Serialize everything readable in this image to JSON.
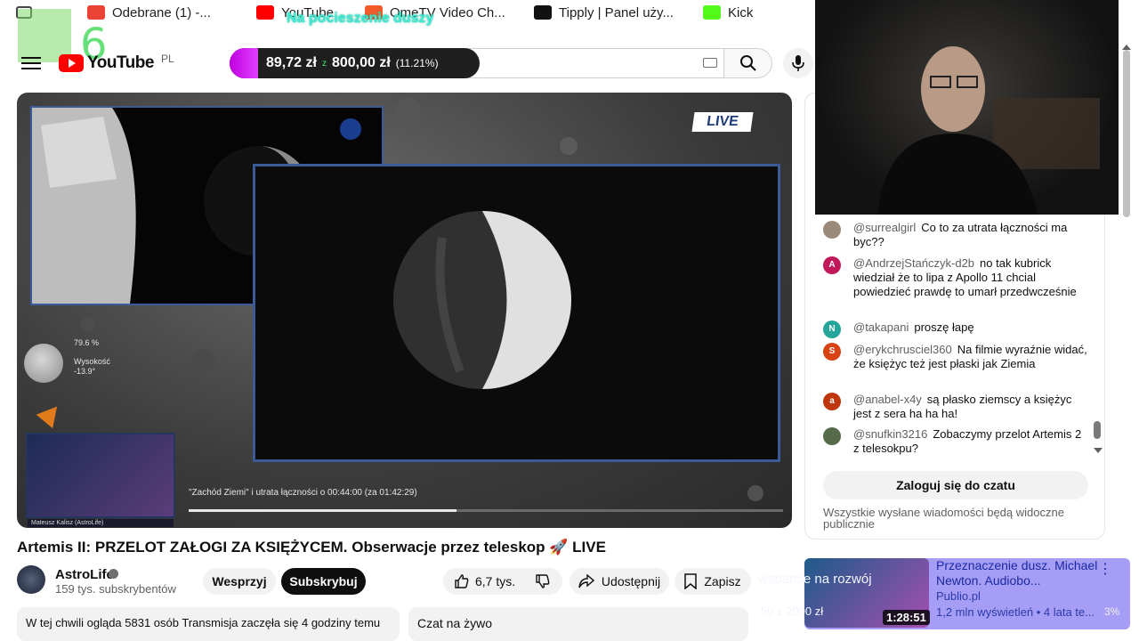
{
  "bookmarks": [
    {
      "label": "Odebrane (1) -...",
      "icon": "gmail-icon",
      "color": "#ea4335"
    },
    {
      "label": "YouTube",
      "icon": "youtube-icon",
      "color": "#ff0000"
    },
    {
      "label": "OmeTV Video Ch...",
      "icon": "ometv-icon",
      "color": "#f45b2a"
    },
    {
      "label": "Tipply | Panel uży...",
      "icon": "tipply-icon",
      "color": "#111111"
    },
    {
      "label": "Kick",
      "icon": "kick-icon",
      "color": "#53fc18"
    }
  ],
  "overlay": {
    "badge_number": "6",
    "stream_title": "Na pocieszenie duszy",
    "donation_amount": "89,72 zł",
    "donation_goal": "800,00 zł",
    "donation_percent": "(11.21%)",
    "donation_progress": 0.1121,
    "goal_label": "wsparcie na rozwój",
    "goal_amount": "50 z 2000 zł"
  },
  "header": {
    "logo_text": "YouTube",
    "country_code": "PL"
  },
  "video": {
    "live_badge": "LIVE",
    "moon_percent": "79.6 %",
    "altitude_label": "Wysokość",
    "altitude_value": "-13.9°",
    "caption": "\"Zachód Ziemi\" i utrata łączności o 00:44:00 (za 01:42:29)",
    "cam_name": "Mateusz Kalisz (AstroLife)",
    "progress": 0.45,
    "title": "Artemis II: PRZELOT ZAŁOGI ZA KSIĘŻYCEM. Obserwacje przez teleskop 🚀 LIVE"
  },
  "channel": {
    "name": "AstroLife",
    "subscribers": "159 tys. subskrybentów",
    "support_label": "Wesprzyj",
    "subscribe_label": "Subskrybuj"
  },
  "actions": {
    "likes": "6,7 tys.",
    "share_label": "Udostępnij",
    "save_label": "Zapisz"
  },
  "description": {
    "text": "W tej chwili ogląda 5831 osób  Transmisja zaczęła się 4 godziny temu"
  },
  "livechat_tab": "Czat na żywo",
  "chat": {
    "messages": [
      {
        "author": "@surrealgirl",
        "text": "Co to za utrata łączności ma byc??",
        "avatar": "",
        "color": "#9b8a7a"
      },
      {
        "author": "@AndrzejStańczyk-d2b",
        "text": "no tak kubrick wiedział że to lipa z Apollo 11 chcial powiedzieć prawdę to umarł przedwcześnie",
        "avatar": "A",
        "color": "#c2185b"
      },
      {
        "author": "@takapani",
        "text": "proszę łapę",
        "avatar": "N",
        "color": "#26a69a"
      },
      {
        "author": "@erykchrusciel360",
        "text": "Na filmie wyraźnie widać, że księżyc też jest płaski jak Ziemia",
        "avatar": "S",
        "color": "#d84315"
      },
      {
        "author": "@anabel-x4y",
        "text": "są płasko ziemscy a księżyc jest z sera ha ha ha!",
        "avatar": "a",
        "color": "#bf360c"
      },
      {
        "author": "@snufkin3216",
        "text": "Zobaczymy przelot Artemis 2 z telesokpu?",
        "avatar": "",
        "color": "#556b4a"
      }
    ],
    "login_label": "Zaloguj się do czatu",
    "note": "Wszystkie wysłane wiadomości będą widoczne publicznie"
  },
  "recommended": {
    "title": "Przeznaczenie dusz. Michael Newton. Audiobo...",
    "author": "Publio.pl",
    "meta": "1,2 mln wyświetleń • 4 lata te...",
    "duration": "1:28:51",
    "percent": "3%"
  }
}
